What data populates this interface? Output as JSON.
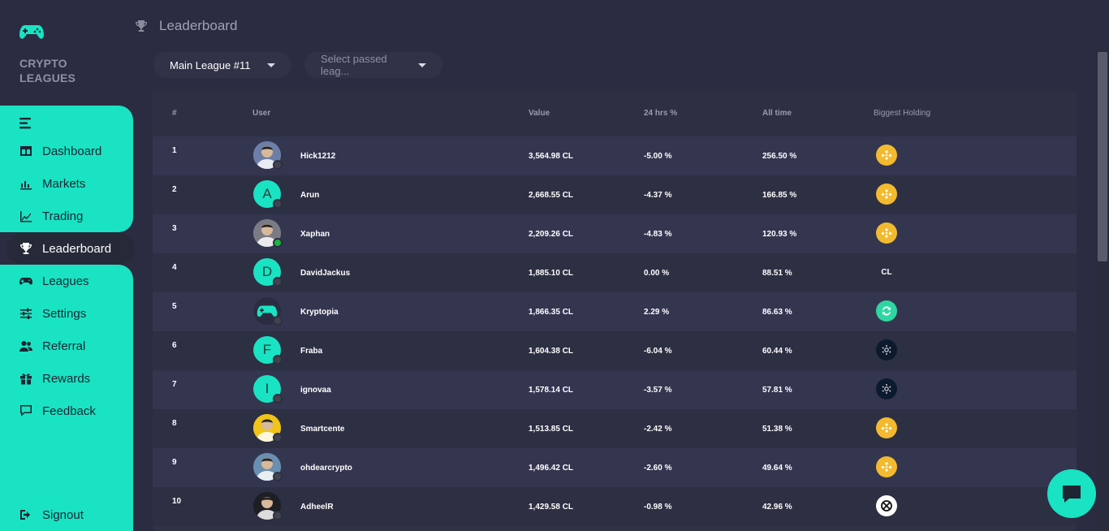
{
  "brand": {
    "name": "CRYPTO LEAGUES",
    "icon": "gamepad-icon"
  },
  "nav": {
    "items": [
      {
        "label": "Dashboard",
        "icon": "dashboard-icon"
      },
      {
        "label": "Markets",
        "icon": "bar-chart-icon"
      },
      {
        "label": "Trading",
        "icon": "line-chart-icon"
      },
      {
        "label": "Leaderboard",
        "icon": "trophy-icon"
      },
      {
        "label": "Leagues",
        "icon": "gamepad-icon"
      },
      {
        "label": "Settings",
        "icon": "sliders-icon"
      },
      {
        "label": "Referral",
        "icon": "users-icon"
      },
      {
        "label": "Rewards",
        "icon": "gift-icon"
      },
      {
        "label": "Feedback",
        "icon": "chat-icon"
      }
    ],
    "signout": "Signout"
  },
  "header": {
    "title": "Leaderboard"
  },
  "filters": {
    "league": "Main League #11",
    "passed": "Select passed leag..."
  },
  "table": {
    "headers": [
      "#",
      "User",
      "Value",
      "24 hrs %",
      "All time",
      "Biggest Holding"
    ],
    "rows": [
      {
        "rank": "1",
        "user": "Hick1212",
        "avatar": "photo",
        "value": "3,564.98 CL",
        "change": "-5.00 %",
        "all": "256.50 %",
        "holding": "bnb-icon"
      },
      {
        "rank": "2",
        "user": "Arun",
        "avatar": "A",
        "value": "2,668.55 CL",
        "change": "-4.37 %",
        "all": "166.85 %",
        "holding": "bnb-icon"
      },
      {
        "rank": "3",
        "user": "Xaphan",
        "avatar": "photo",
        "value": "2,209.26 CL",
        "change": "-4.83 %",
        "all": "120.93 %",
        "holding": "bnb-icon"
      },
      {
        "rank": "4",
        "user": "DavidJackus",
        "avatar": "D",
        "value": "1,885.10 CL",
        "change": "0.00 %",
        "all": "88.51 %",
        "holding": "CL"
      },
      {
        "rank": "5",
        "user": "Kryptopia",
        "avatar": "gamepad",
        "value": "1,866.35 CL",
        "change": "2.29 %",
        "all": "86.63 %",
        "holding": "swap-icon"
      },
      {
        "rank": "6",
        "user": "Fraba",
        "avatar": "F",
        "value": "1,604.38 CL",
        "change": "-6.04 %",
        "all": "60.44 %",
        "holding": "cardano-icon"
      },
      {
        "rank": "7",
        "user": "ignovaa",
        "avatar": "I",
        "value": "1,578.14 CL",
        "change": "-3.57 %",
        "all": "57.81 %",
        "holding": "cardano-icon"
      },
      {
        "rank": "8",
        "user": "Smartcente",
        "avatar": "photo",
        "value": "1,513.85 CL",
        "change": "-2.42 %",
        "all": "51.38 %",
        "holding": "bnb-icon"
      },
      {
        "rank": "9",
        "user": "ohdearcrypto",
        "avatar": "photo",
        "value": "1,496.42 CL",
        "change": "-2.60 %",
        "all": "49.64 %",
        "holding": "bnb-icon"
      },
      {
        "rank": "10",
        "user": "AdheelR",
        "avatar": "photo",
        "value": "1,429.58 CL",
        "change": "-0.98 %",
        "all": "42.96 %",
        "holding": "ox-icon"
      }
    ]
  },
  "colors": {
    "accent": "#19e3c2",
    "bg": "#2b2c41",
    "panel": "#303246",
    "bnb": "#f3ba2f",
    "online": "#17b83a"
  }
}
